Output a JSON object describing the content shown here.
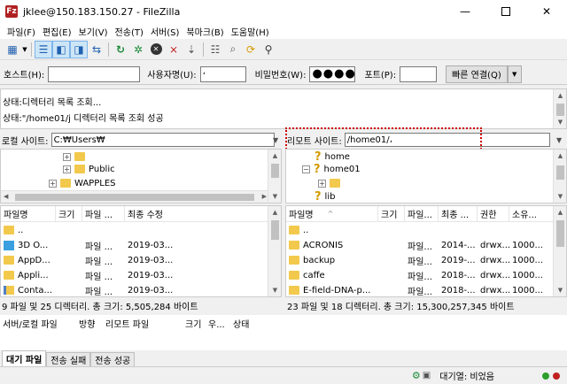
{
  "window": {
    "title": "jklee@150.183.150.27 - FileZilla",
    "app_icon": "Fz"
  },
  "menu": [
    "파일(F)",
    "편집(E)",
    "보기(V)",
    "전송(T)",
    "서버(S)",
    "북마크(B)",
    "도움말(H)"
  ],
  "quickconnect": {
    "host_label": "호스트(H):",
    "host_value": "",
    "user_label": "사용자명(U):",
    "user_value": "،",
    "pass_label": "비밀번호(W):",
    "pass_value": "●●●●",
    "port_label": "포트(P):",
    "port_value": "",
    "connect_label": "빠른 연결(Q)"
  },
  "messages": [
    "상태:디렉터리 목록 조회...",
    "상태:\"/home01/j        디렉터리 목록 조회 성공"
  ],
  "local": {
    "site_label": "로컬 사이트:",
    "site_path": "C:₩Users₩",
    "tree": [
      {
        "label": "",
        "expander": "+"
      },
      {
        "label": "Public",
        "expander": "+"
      },
      {
        "label": "WAPPLES",
        "expander": "+"
      }
    ],
    "headers": [
      "파일명",
      "크기",
      "파일 ...",
      "최종 수정"
    ],
    "files": [
      {
        "name": "..",
        "size": "",
        "type": "",
        "modified": ""
      },
      {
        "name": "3D O...",
        "size": "",
        "type": "파일 ...",
        "modified": "2019-03..."
      },
      {
        "name": "AppD...",
        "size": "",
        "type": "파일 ...",
        "modified": "2019-03..."
      },
      {
        "name": "Appli...",
        "size": "",
        "type": "파일 ...",
        "modified": "2019-03..."
      },
      {
        "name": "Conta...",
        "size": "",
        "type": "파일 ...",
        "modified": "2019-03..."
      }
    ],
    "summary": "9 파일 및 25 디렉터리. 총 크기: 5,505,284 바이트"
  },
  "remote": {
    "site_label": "리모트 사이트:",
    "site_path": "/home01/،",
    "tree": [
      {
        "label": "home",
        "expander": ""
      },
      {
        "label": "home01",
        "expander": "−"
      },
      {
        "label": "",
        "expander": "+"
      },
      {
        "label": "lib",
        "expander": ""
      }
    ],
    "headers": [
      "파일명",
      "크기",
      "파일...",
      "최종 ...",
      "권한",
      "소유..."
    ],
    "files": [
      {
        "name": "..",
        "size": "",
        "type": "",
        "modified": "",
        "perms": "",
        "owner": ""
      },
      {
        "name": "ACRONIS",
        "size": "",
        "type": "파일...",
        "modified": "2014-...",
        "perms": "drwx...",
        "owner": "1000..."
      },
      {
        "name": "backup",
        "size": "",
        "type": "파일...",
        "modified": "2019-...",
        "perms": "drwx...",
        "owner": "1000..."
      },
      {
        "name": "caffe",
        "size": "",
        "type": "파일...",
        "modified": "2018-...",
        "perms": "drwx...",
        "owner": "1000..."
      },
      {
        "name": "E-field-DNA-p...",
        "size": "",
        "type": "파일...",
        "modified": "2018-...",
        "perms": "drwx...",
        "owner": "1000..."
      }
    ],
    "summary": "23 파일 및 18 디렉터리. 총 크기: 15,300,257,345 바이트"
  },
  "queue": {
    "headers": [
      "서버/로컬 파일",
      "방향",
      "리모트 파일",
      "크기",
      "우...",
      "상태"
    ],
    "tabs": [
      "대기 파일",
      "전송 실패",
      "전송 성공"
    ],
    "status_text": "대기열: 비었음"
  },
  "colors": {
    "accent": "#0078d7",
    "folder": "#f2c94c",
    "highlight_border": "#d00000",
    "status_green": "#2e9e2e",
    "status_red": "#c02020"
  }
}
